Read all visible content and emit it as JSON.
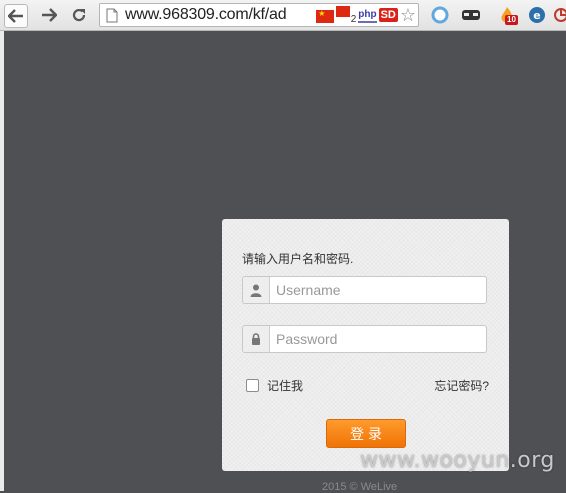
{
  "browser": {
    "url": "www.968309.com/kf/ad",
    "flag_badge": "2",
    "php_label": "php",
    "sd_label": "SD",
    "ext_badge": "10"
  },
  "login": {
    "prompt": "请输入用户名和密码.",
    "username_placeholder": "Username",
    "password_placeholder": "Password",
    "remember_label": "记住我",
    "forgot_label": "忘记密码?",
    "submit_label": "登录",
    "copyright": "2015 © WeLive"
  },
  "watermark": "www.wooyun.org",
  "colors": {
    "page_background": "#4f5054",
    "panel_background": "#f0f0f0",
    "button_orange": "#f68a1c"
  },
  "icons": {
    "back": "arrow-left-icon",
    "forward": "arrow-right-icon",
    "reload": "reload-icon",
    "page": "page-icon",
    "bookmark": "star-icon",
    "username": "user-icon",
    "password": "lock-icon"
  }
}
